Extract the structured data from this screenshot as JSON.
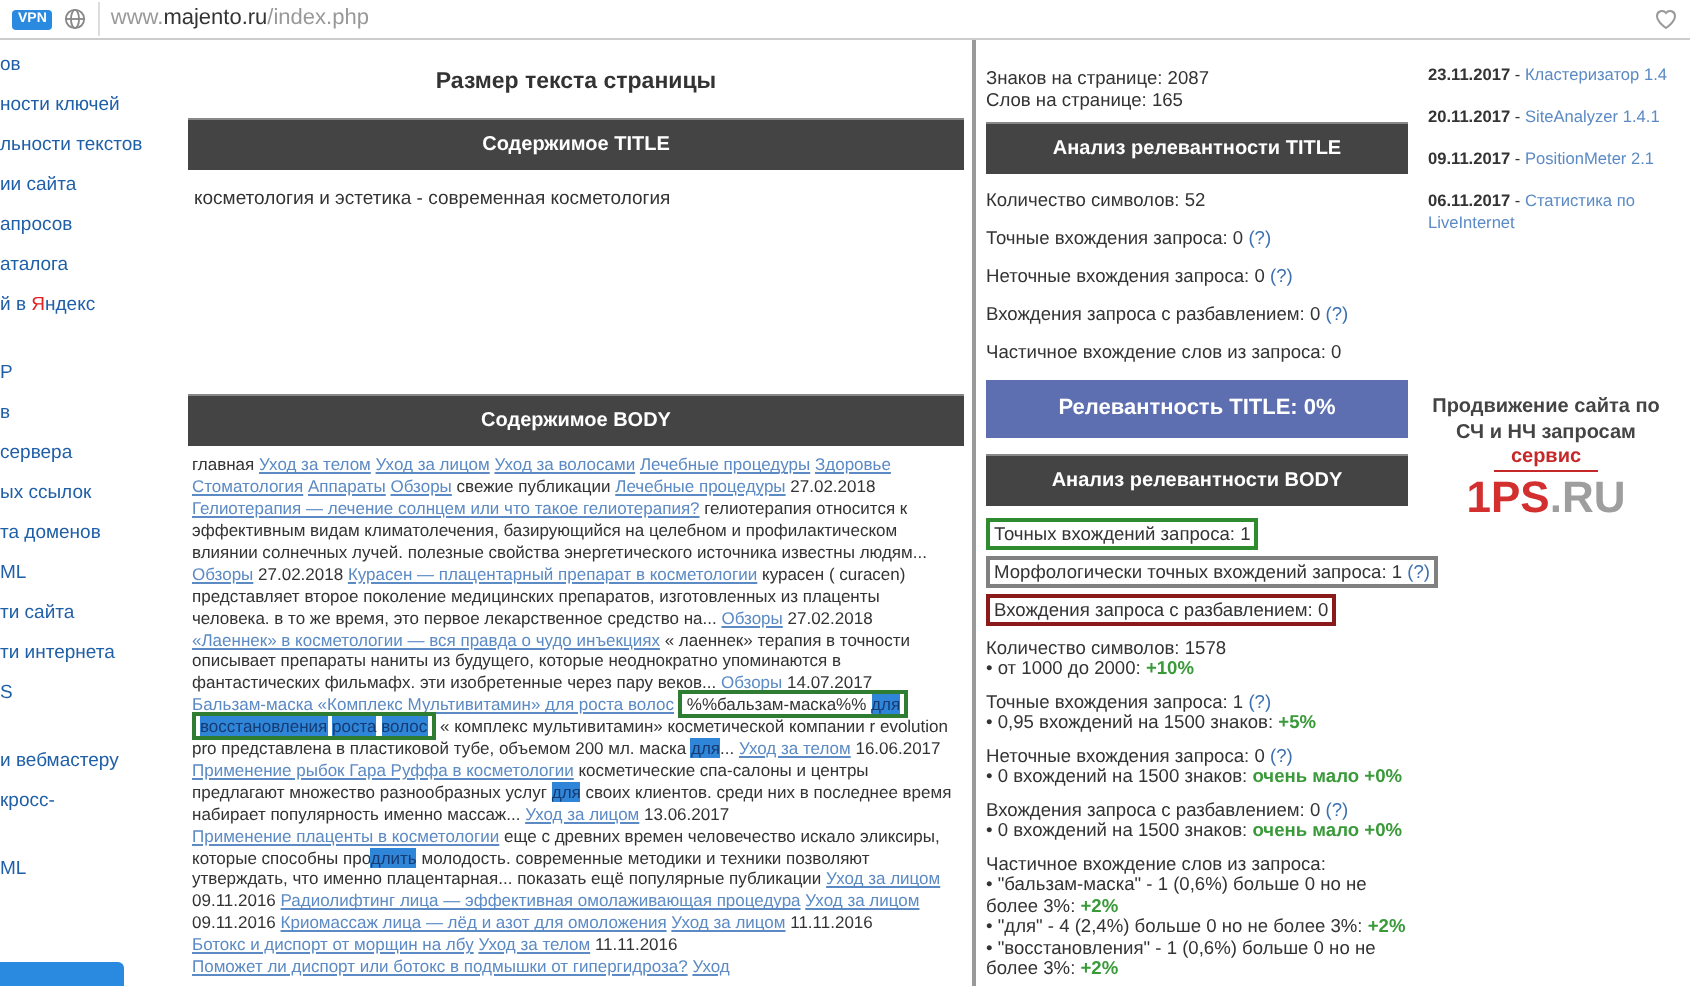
{
  "browser": {
    "vpn": "VPN",
    "url_prefix": "www.",
    "url_host": "majento.ru",
    "url_path": "/index.php"
  },
  "sidebar": {
    "groups": [
      {
        "items": [
          {
            "parts": [
              {
                "text": "ов"
              }
            ]
          },
          {
            "parts": [
              {
                "text": "ности ключей"
              }
            ]
          },
          {
            "parts": [
              {
                "text": "льности текстов"
              }
            ]
          },
          {
            "parts": [
              {
                "text": "ии сайта"
              }
            ]
          },
          {
            "parts": [
              {
                "text": "апросов"
              }
            ]
          },
          {
            "parts": [
              {
                "text": "аталога"
              }
            ]
          },
          {
            "parts": [
              {
                "text": "й в "
              },
              {
                "text": "Я",
                "accent": true
              },
              {
                "text": "ндекс"
              }
            ]
          }
        ]
      },
      {
        "items": [
          {
            "parts": [
              {
                "text": "P"
              }
            ]
          },
          {
            "parts": [
              {
                "text": "в"
              }
            ]
          },
          {
            "parts": [
              {
                "text": "сервера"
              }
            ]
          },
          {
            "parts": [
              {
                "text": "ых ссылок"
              }
            ]
          },
          {
            "parts": [
              {
                "text": "та доменов"
              }
            ]
          },
          {
            "parts": [
              {
                "text": "ML"
              }
            ]
          },
          {
            "parts": [
              {
                "text": "ти сайта"
              }
            ]
          },
          {
            "parts": [
              {
                "text": "ти интернета"
              }
            ]
          },
          {
            "parts": [
              {
                "text": "S"
              }
            ]
          }
        ]
      },
      {
        "items": [
          {
            "parts": [
              {
                "text": "и вебмастеру"
              }
            ]
          },
          {
            "parts": [
              {
                "text": "кросс-"
              }
            ]
          }
        ]
      },
      {
        "items": [
          {
            "parts": [
              {
                "text": "ML"
              }
            ]
          }
        ]
      }
    ],
    "has_button": true
  },
  "size_title": "Размер текста страницы",
  "title_header": "Содержимое TITLE",
  "title_content": "косметология и эстетика - современная косметология",
  "body_header": "Содержимое BODY",
  "body_segments": [
    {
      "kind": "text",
      "text": "главная "
    },
    {
      "kind": "link",
      "text": "Уход за телом"
    },
    {
      "kind": "link",
      "text": "Уход за лицом"
    },
    {
      "kind": "link",
      "text": "Уход за волосами"
    },
    {
      "kind": "link",
      "text": "Лечебные процедуры"
    },
    {
      "kind": "link",
      "text": "Здоровье"
    },
    {
      "kind": "link",
      "text": "Стоматология"
    },
    {
      "kind": "link",
      "text": "Аппараты"
    },
    {
      "kind": "link",
      "text": "Обзоры"
    },
    {
      "kind": "text",
      "text": " свежие публикации "
    },
    {
      "kind": "link",
      "text": "Лечебные процедуры"
    },
    {
      "kind": "text",
      "text": " 27.02.2018 "
    },
    {
      "kind": "link",
      "text": "Гелиотерапия — лечение солнцем или что такое гелиотерапия?"
    },
    {
      "kind": "text",
      "text": " гелиотерапия относится к эффективным видам климатолечения, базирующийся на целебном и профилактическом влиянии солнечных лучей. полезные свойства энергетического источника известны людям... "
    },
    {
      "kind": "link",
      "text": "Обзоры"
    },
    {
      "kind": "text",
      "text": " 27.02.2018 "
    },
    {
      "kind": "link",
      "text": "Курасен — плацентарный препарат в косметологии"
    },
    {
      "kind": "text",
      "text": " курасен ( curacen) представляет второе поколение медицинских препаратов, изготовленных из плаценты человека. в то же время, это первое лекарственное средство на... "
    },
    {
      "kind": "link",
      "text": "Обзоры"
    },
    {
      "kind": "text",
      "text": " 27.02.2018 "
    },
    {
      "kind": "link",
      "text": "«Лаеннек» в косметологии — вся правда о чудо инъекциях"
    },
    {
      "kind": "text",
      "text": " « лаеннек» терапия в точности описывает препараты наниты из будущего, которые неоднократно упоминаются в фантастических фильмафх. эти изобретенные через пару веков... "
    },
    {
      "kind": "link",
      "text": "Обзоры"
    },
    {
      "kind": "text",
      "text": " 14.07.2017 "
    },
    {
      "kind": "link",
      "text": "Бальзам-маска «Комплекс Мультивитамин» для роста волос"
    },
    {
      "kind": "query",
      "parts": [
        {
          "kind": "text",
          "text": "%%бальзам-маска%% "
        },
        {
          "kind": "hl",
          "text": "для"
        },
        {
          "kind": "hl",
          "text": "восстановления"
        },
        {
          "kind": "hl",
          "text": "роста"
        },
        {
          "kind": "hl",
          "text": "волос"
        }
      ]
    },
    {
      "kind": "text",
      "text": " « комплекс мультивитамин» косметической компании r evolution pro представлена в пластиковой тубе, объемом 200 мл. маска "
    },
    {
      "kind": "hl",
      "text": "для"
    },
    {
      "kind": "text",
      "text": "... "
    },
    {
      "kind": "link",
      "text": "Уход за телом"
    },
    {
      "kind": "text",
      "text": " 16.06.2017 "
    },
    {
      "kind": "link",
      "text": "Применение рыбок Гара Руффа в косметологии"
    },
    {
      "kind": "text",
      "text": " косметические спа-салоны и центры предлагают множество разнообразных услуг "
    },
    {
      "kind": "hl",
      "text": "для"
    },
    {
      "kind": "text",
      "text": " своих клиентов. среди них в последнее время набирает популярность именно массаж... "
    },
    {
      "kind": "link",
      "text": "Уход за лицом"
    },
    {
      "kind": "text",
      "text": " 13.06.2017 "
    },
    {
      "kind": "link",
      "text": "Применение плаценты в косметологии"
    },
    {
      "kind": "text",
      "text": " еще с древних времен человечество искало эликсиры, которые способны про"
    },
    {
      "kind": "hl",
      "text": "длить"
    },
    {
      "kind": "text",
      "text": " молодость. современные методики и техники позволяют утверждать, что именно плацентарная... показать ещё популярные публикации "
    },
    {
      "kind": "link",
      "text": "Уход за лицом"
    },
    {
      "kind": "text",
      "text": " 09.11.2016 "
    },
    {
      "kind": "link",
      "text": "Радиолифтинг лица — эффективная омолаживающая процедура"
    },
    {
      "kind": "link",
      "text": "Уход за лицом"
    },
    {
      "kind": "text",
      "text": " 09.11.2016 "
    },
    {
      "kind": "link",
      "text": "Криомассаж лица — лёд и азот для омоложения"
    },
    {
      "kind": "link",
      "text": "Уход за лицом"
    },
    {
      "kind": "text",
      "text": " 11.11.2016 "
    },
    {
      "kind": "link",
      "text": "Ботокс и диспорт от морщин на лбу"
    },
    {
      "kind": "link",
      "text": "Уход за телом"
    },
    {
      "kind": "text",
      "text": " 11.11.2016 "
    },
    {
      "kind": "link",
      "text": "Поможет ли диспорт или ботокс в подмышки от гипергидроза?"
    },
    {
      "kind": "link",
      "text": "Уход"
    }
  ],
  "page_stats": [
    "Знаков на странице: 2087",
    "Слов на странице: 165"
  ],
  "title_analysis": {
    "header": "Анализ релевантности TITLE",
    "items": [
      {
        "text": "Количество символов: 52"
      },
      {
        "text": "Точные вхождения запроса: 0 ",
        "help": "(?)"
      },
      {
        "text": "Неточные вхождения запроса: 0 ",
        "help": "(?)"
      },
      {
        "text": "Вхождения запроса с разбавлением: 0 ",
        "help": "(?)"
      },
      {
        "text": "Частичное вхождение слов из запроса: 0"
      }
    ],
    "relevance": "Релевантность TITLE: 0%"
  },
  "body_analysis": {
    "header": "Анализ релевантности BODY",
    "boxes": [
      {
        "text": "Точных вхождений запроса: 1",
        "color": "#2e8b2e"
      },
      {
        "text": "Морфологически точных вхождений запроса: 1 ",
        "help": "(?)",
        "color": "#808080"
      },
      {
        "text": "Вхождения запроса с разбавлением: 0",
        "color": "#8b1a1a"
      }
    ],
    "blocks": [
      {
        "lines": [
          {
            "text": "Количество символов: 1578"
          },
          {
            "text": "• от 1000 до 2000: ",
            "value": "+10%"
          }
        ]
      },
      {
        "lines": [
          {
            "text": "Точные вхождения запроса: 1 ",
            "help": "(?)"
          },
          {
            "text": "• 0,95 вхождений на 1500 знаков: ",
            "value": "+5%"
          }
        ]
      },
      {
        "lines": [
          {
            "text": "Неточные вхождения запроса: 0 ",
            "help": "(?)"
          },
          {
            "text": "• 0 вхождений на 1500 знаков: ",
            "value": "очень мало +0%"
          }
        ]
      },
      {
        "lines": [
          {
            "text": "Вхождения запроса с разбавлением: 0 ",
            "help": "(?)"
          },
          {
            "text": "• 0 вхождений на 1500 знаков: ",
            "value": "очень мало +0%"
          }
        ]
      },
      {
        "lines": [
          {
            "text": "Частичное вхождение слов из запроса:"
          },
          {
            "text": "• \"бальзам-маска\" - 1 (0,6%) больше 0 но не более 3%: ",
            "value": "+2%"
          },
          {
            "text": "• \"для\" - 4 (2,4%) больше 0 но не более 3%: ",
            "value": "+2%"
          },
          {
            "text": "• \"восстановления\" - 1 (0,6%) больше 0 но не более 3%: ",
            "value": "+2%"
          }
        ]
      }
    ]
  },
  "news": [
    {
      "date": "23.11.2017",
      "separator": "-",
      "title": "Кластеризатор 1.4"
    },
    {
      "date": "20.11.2017",
      "separator": "-",
      "title": "SiteAnalyzer 1.4.1"
    },
    {
      "date": "09.11.2017",
      "separator": "-",
      "title": "PositionMeter 2.1"
    },
    {
      "date": "06.11.2017",
      "separator": "-",
      "title": "Статистика по LiveInternet"
    }
  ],
  "banner": {
    "headline": "Продвижение сайта по СЧ и НЧ запросам",
    "service": "сервис",
    "logo_accent": "1PS",
    "logo_rest": ".RU"
  }
}
